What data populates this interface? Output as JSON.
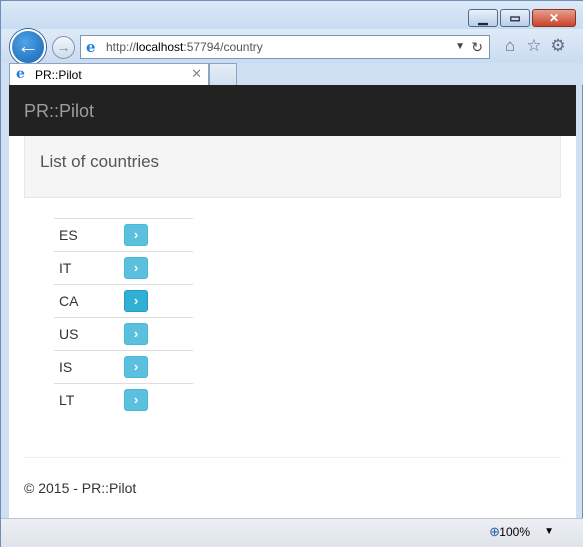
{
  "browser": {
    "url_prefix": "http://",
    "url_host": "localhost",
    "url_rest": ":57794/country",
    "tab_title": "PR::Pilot",
    "zoom": "100%"
  },
  "site": {
    "brand": "PR::Pilot",
    "heading": "List of countries",
    "countries": [
      "ES",
      "IT",
      "CA",
      "US",
      "IS",
      "LT"
    ],
    "footer": "© 2015 - PR::Pilot"
  },
  "colors": {
    "navbar": "#222222",
    "button": "#5bc0de"
  },
  "icons": {
    "back": "back-arrow-icon",
    "forward": "forward-arrow-icon",
    "site": "ie-logo-icon",
    "home": "home-icon",
    "favorites": "star-icon",
    "tools": "gear-icon",
    "row_action": "chevron-right-icon",
    "zoom": "zoom-icon"
  }
}
